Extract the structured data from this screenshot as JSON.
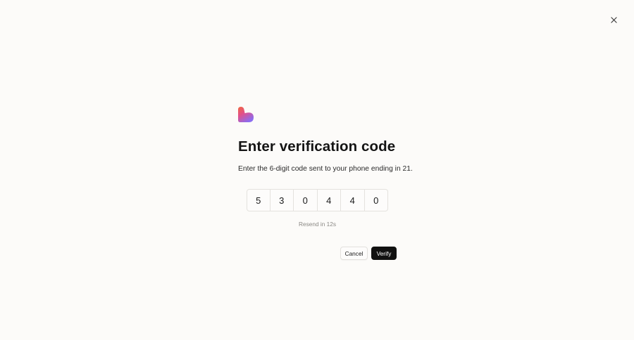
{
  "dialog": {
    "close_icon": "close-icon",
    "logo_icon": "heart-logo-icon",
    "title": "Enter verification code",
    "subtitle": "Enter the 6-digit code sent to your phone ending in 21.",
    "code_digits": [
      "5",
      "3",
      "0",
      "4",
      "4",
      "0"
    ],
    "resend_text": "Resend in 12s",
    "cancel_label": "Cancel",
    "verify_label": "Verify"
  },
  "colors": {
    "background": "#fcfbf9",
    "primary_button": "#111111",
    "logo_top": "#e85d4a",
    "logo_bottom": "#8b6cf0"
  }
}
